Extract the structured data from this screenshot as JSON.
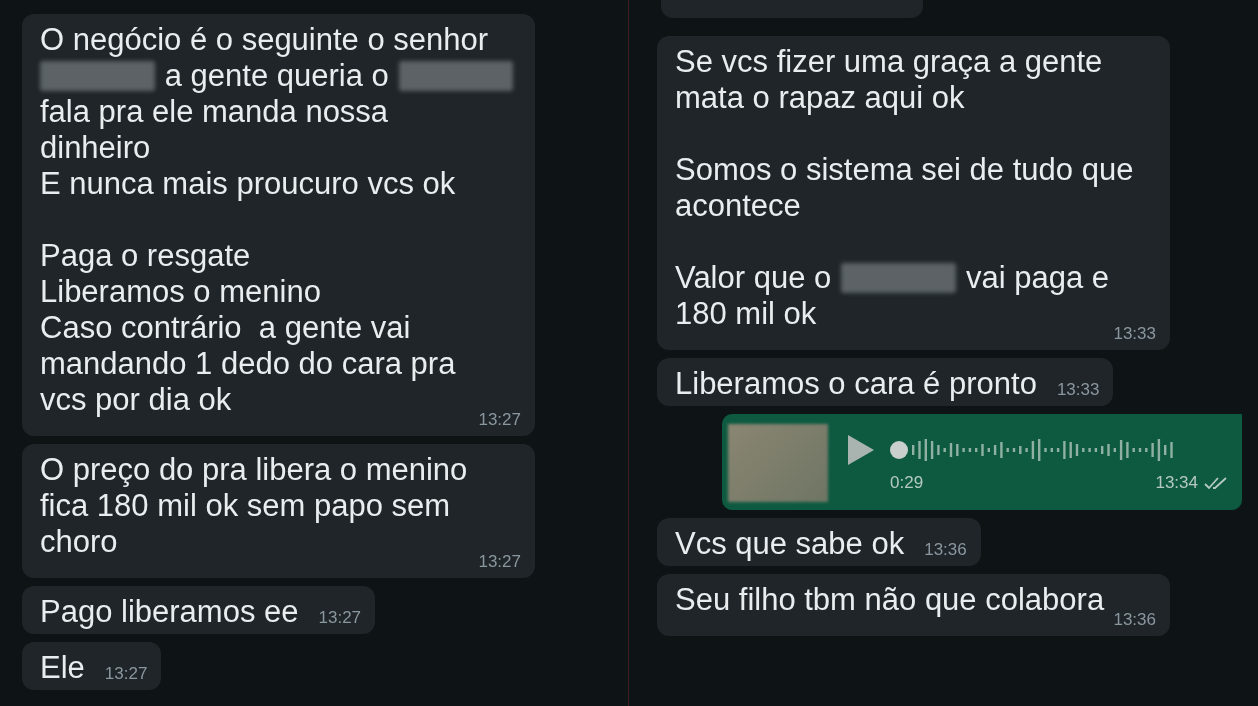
{
  "panels": [
    {
      "messages": [
        {
          "kind": "text",
          "outgoing": false,
          "paragraphs": [
            [
              {
                "text": "O negócio é o seguinte o senhor"
              },
              {
                "parts": [
                  {
                    "kind": "redacted"
                  },
                  {
                    "kind": "text",
                    "text": "a gente queria o"
                  },
                  {
                    "kind": "redacted"
                  }
                ]
              },
              {
                "text": "fala pra ele manda nossa"
              },
              {
                "text": "dinheiro"
              },
              {
                "text": "E nunca mais proucuro vcs ok"
              }
            ],
            [
              {
                "text": "Paga o resgate"
              },
              {
                "text": "Liberamos o menino"
              },
              {
                "text": "Caso contrário  a gente vai"
              },
              {
                "text": "mandando 1 dedo do cara pra"
              },
              {
                "text": "vcs por dia ok"
              }
            ]
          ],
          "time": "13:27"
        },
        {
          "kind": "text",
          "outgoing": false,
          "paragraphs": [
            [
              {
                "text": "O preço do pra libera o menino"
              },
              {
                "text": "fica 180 mil ok sem papo sem"
              },
              {
                "text": "choro"
              }
            ]
          ],
          "time": "13:27"
        },
        {
          "kind": "text",
          "outgoing": false,
          "paragraphs": [
            [
              {
                "text": "Pago liberamos ee"
              }
            ]
          ],
          "time": "13:27"
        },
        {
          "kind": "text",
          "outgoing": false,
          "paragraphs": [
            [
              {
                "text": "Ele"
              }
            ]
          ],
          "time": "13:27"
        }
      ]
    },
    {
      "messages": [
        {
          "kind": "clipped"
        },
        {
          "kind": "text",
          "outgoing": false,
          "paragraphs": [
            [
              {
                "text": "Se vcs fizer uma graça a gente"
              },
              {
                "text": "mata o rapaz aqui ok"
              }
            ],
            [
              {
                "text": "Somos o sistema sei de tudo que"
              },
              {
                "text": "acontece"
              }
            ],
            [
              {
                "parts": [
                  {
                    "kind": "text",
                    "text": "Valor que o"
                  },
                  {
                    "kind": "redacted"
                  },
                  {
                    "kind": "text",
                    "text": "vai paga e"
                  }
                ]
              },
              {
                "text": "180 mil ok"
              }
            ]
          ],
          "time": "13:33"
        },
        {
          "kind": "text",
          "outgoing": false,
          "paragraphs": [
            [
              {
                "text": "Liberamos o cara é pronto"
              }
            ]
          ],
          "time": "13:33"
        },
        {
          "kind": "voice",
          "outgoing": true,
          "duration": "0:29",
          "time": "13:34"
        },
        {
          "kind": "text",
          "outgoing": false,
          "paragraphs": [
            [
              {
                "text": "Vcs que sabe ok"
              }
            ]
          ],
          "time": "13:36"
        },
        {
          "kind": "text",
          "outgoing": false,
          "paragraphs": [
            [
              {
                "text": "Seu filho tbm não que colabora"
              }
            ]
          ],
          "time": "13:36"
        }
      ]
    }
  ]
}
